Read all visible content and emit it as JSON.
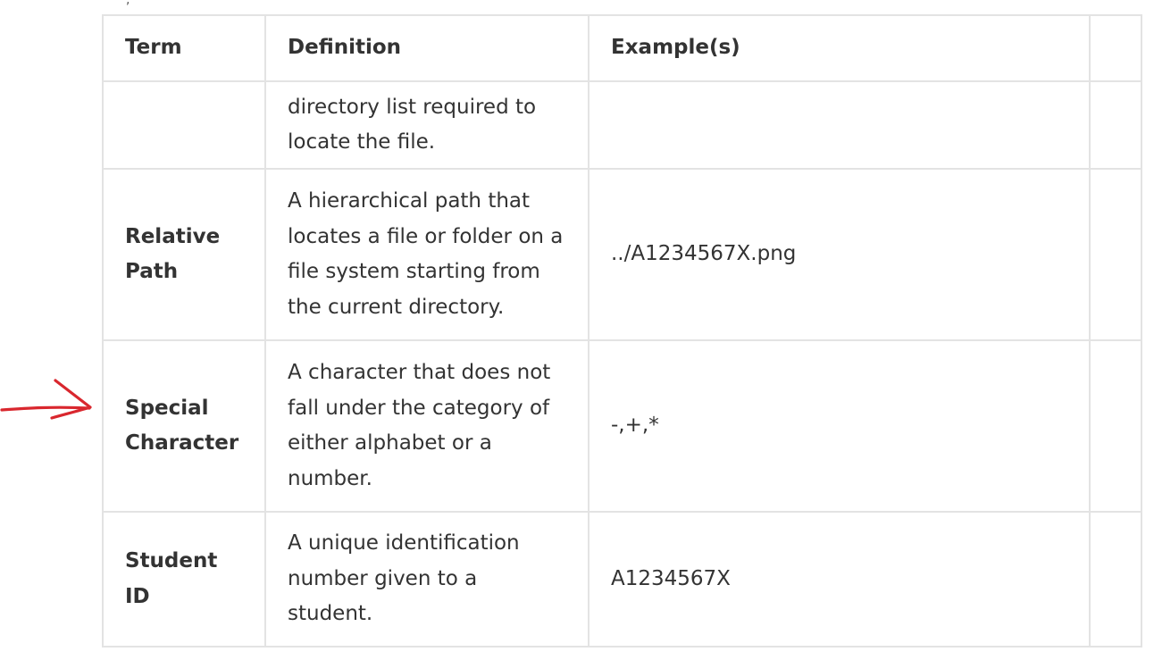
{
  "stray_mark": ",",
  "table": {
    "headers": [
      "Term",
      "Definition",
      "Example(s)",
      ""
    ],
    "continued_row": {
      "term": "",
      "definition": "directory list required to locate the file.",
      "example": ""
    },
    "rows": [
      {
        "term": "Relative Path",
        "definition": "A hierarchical path that locates a file or folder on a file system starting from the current directory.",
        "example": "../A1234567X.png"
      },
      {
        "term": "Special Character",
        "definition": "A character that does not fall under the category of either alphabet or a number.",
        "example": "-,+,*"
      },
      {
        "term": "Student ID",
        "definition": "A unique identification number given to a student.",
        "example": "A1234567X"
      }
    ]
  },
  "annotation": {
    "color": "#d9272e",
    "icon": "hand-drawn-arrow-icon"
  }
}
